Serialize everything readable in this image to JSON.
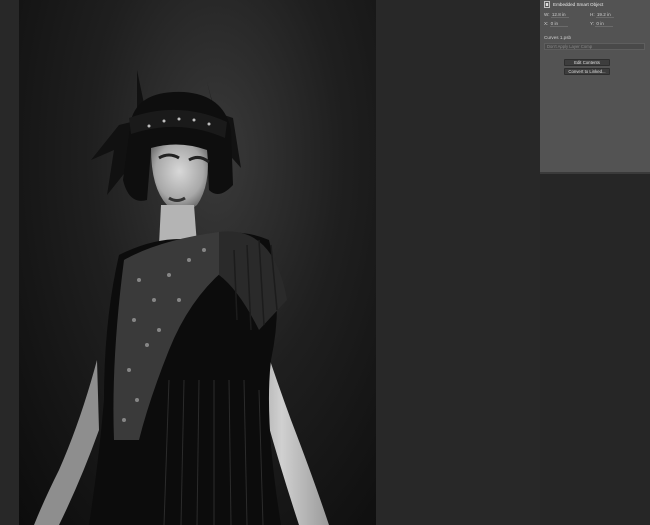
{
  "properties_panel": {
    "layer_type": "Embedded Smart Object",
    "icon": "smart-object-icon",
    "width_label": "W:",
    "width_value": "12.8 in",
    "height_label": "H:",
    "height_value": "19.2 in",
    "x_label": "X:",
    "x_value": "0 in",
    "y_label": "Y:",
    "y_value": "0 in",
    "file_name": "Curves 1.psb",
    "layer_comp_placeholder": "Don't Apply Layer Comp",
    "edit_contents_label": "Edit Contents",
    "convert_to_linked_label": "Convert to Linked..."
  },
  "canvas": {
    "image_subject": "black-and-white-portrait",
    "background_color": "#282828"
  }
}
